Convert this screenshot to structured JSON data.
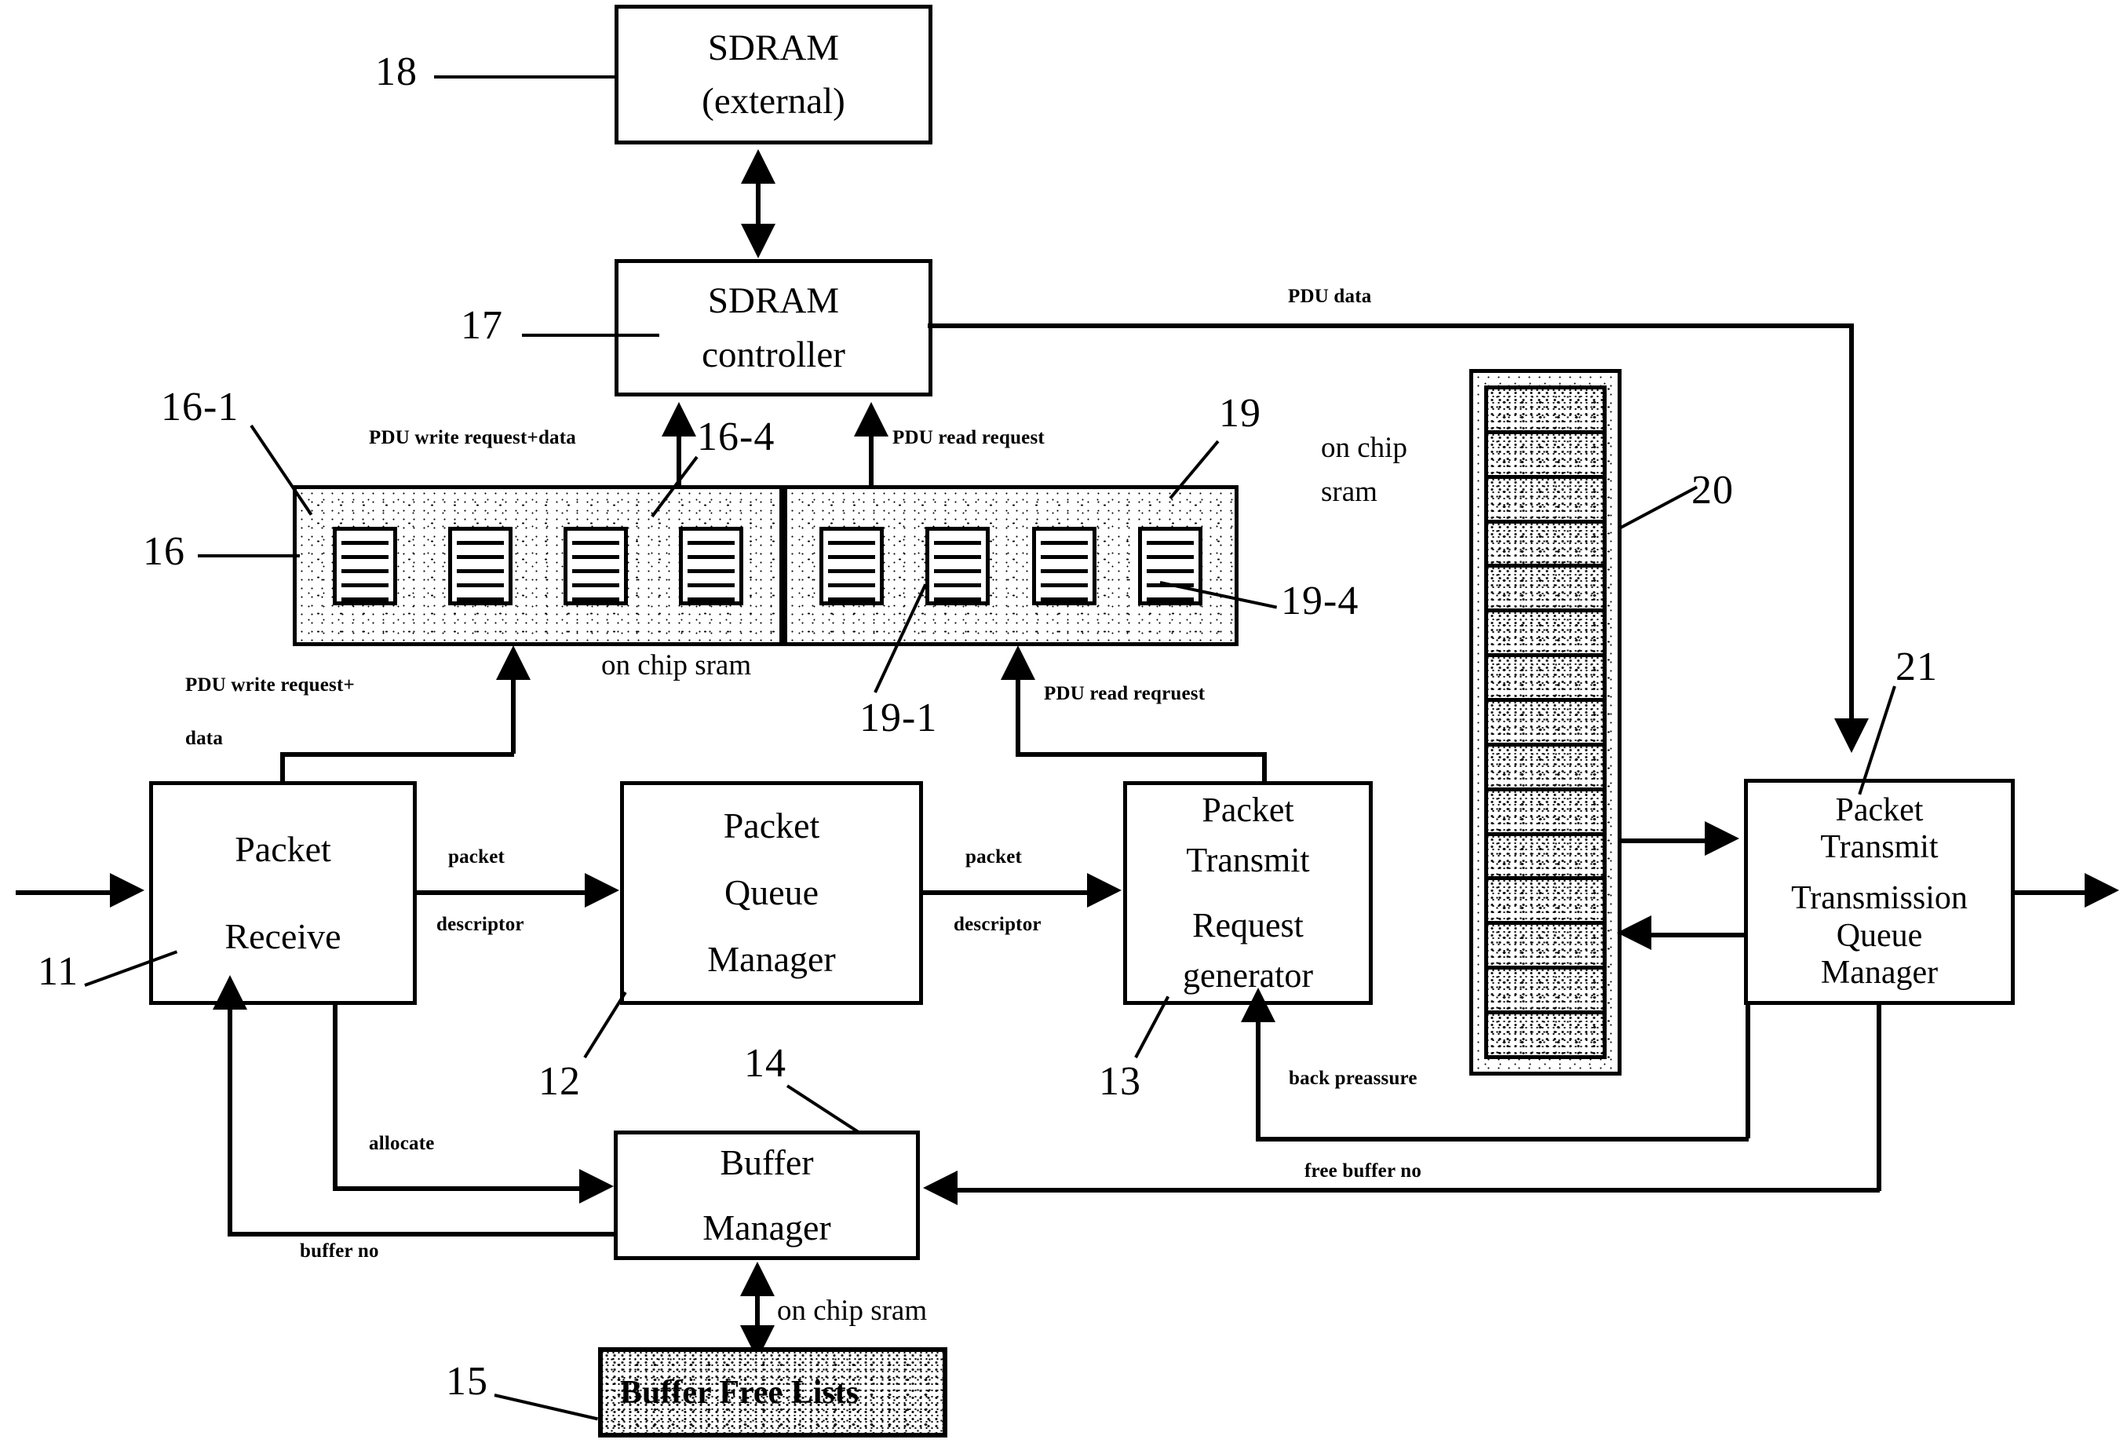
{
  "diagram": {
    "title": "Packet processing architecture block diagram",
    "boxes": {
      "sdram_external": {
        "lines": [
          "SDRAM",
          "(external)"
        ],
        "ref": "18"
      },
      "sdram_controller": {
        "lines": [
          "SDRAM",
          "controller"
        ],
        "ref": "17"
      },
      "packet_receive": {
        "lines": [
          "Packet",
          "Receive"
        ],
        "ref": "11"
      },
      "packet_queue_manager": {
        "lines": [
          "Packet",
          "Queue",
          "Manager"
        ],
        "ref": "12"
      },
      "packet_transmit_request_generator": {
        "lines": [
          "Packet",
          "Transmit",
          "Request",
          "generator"
        ],
        "ref": "13"
      },
      "buffer_manager": {
        "lines": [
          "Buffer",
          "Manager"
        ],
        "ref": "14"
      },
      "buffer_free_lists": {
        "lines": [
          "Buffer Free Lists"
        ],
        "ref": "15"
      },
      "packet_transmit_tx_queue_manager": {
        "lines": [
          "Packet",
          "Transmit",
          "Transmission",
          "Queue",
          "Manager"
        ],
        "ref": "21"
      }
    },
    "sram_blocks": {
      "write_block": {
        "ref": "16",
        "first_buffer_ref": "16-1",
        "last_buffer_ref": "16-4",
        "buffer_count": 4
      },
      "read_block": {
        "ref": "19",
        "first_buffer_ref": "19-1",
        "last_buffer_ref": "19-4",
        "buffer_count": 4
      },
      "caption": "on chip sram"
    },
    "queue_memory": {
      "ref": "20",
      "caption_lines": [
        "on chip",
        "sram"
      ],
      "cell_count": 15
    },
    "free_list_caption": "on chip sram",
    "edge_labels": {
      "pdu_write_request_data_top": "PDU write request+data",
      "pdu_read_request_top": "PDU read request",
      "pdu_write_request_line1": "PDU write request+",
      "pdu_write_request_line2": "data",
      "pdu_read_reqruest": "PDU read reqruest",
      "pdu_data": "PDU data",
      "packet_descriptor_1_line1": "packet",
      "packet_descriptor_1_line2": "descriptor",
      "packet_descriptor_2_line1": "packet",
      "packet_descriptor_2_line2": "descriptor",
      "allocate": "allocate",
      "buffer_no": "buffer no",
      "free_buffer_no": "free buffer no",
      "back_preassure": "back preassure"
    },
    "colors": {
      "ink": "#000000",
      "paper": "#ffffff"
    }
  }
}
